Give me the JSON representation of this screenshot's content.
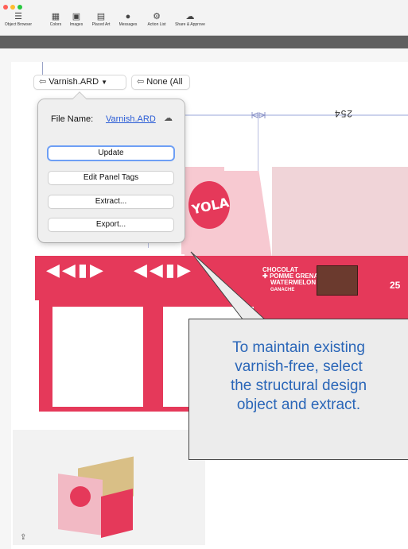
{
  "toolbar": {
    "items": [
      {
        "label": "Object Browser",
        "icon": "object-browser-icon",
        "glyph": "☰"
      },
      {
        "label": "Colors",
        "icon": "colors-icon",
        "glyph": "▦"
      },
      {
        "label": "Images",
        "icon": "images-icon",
        "glyph": "▣"
      },
      {
        "label": "Placed Art",
        "icon": "placed-art-icon",
        "glyph": "▤"
      },
      {
        "label": "Messages",
        "icon": "messages-icon",
        "glyph": "●"
      },
      {
        "label": "Action List",
        "icon": "action-list-icon",
        "glyph": "⚙"
      },
      {
        "label": "Share & Approve",
        "icon": "share-approve-icon",
        "glyph": "☁"
      }
    ]
  },
  "selectors": {
    "varnish": "Varnish.ARD",
    "none": "None (All"
  },
  "popover": {
    "file_name_label": "File Name:",
    "file_name_value": "Varnish.ARD",
    "update": "Update",
    "edit_panel_tags": "Edit Panel Tags",
    "extract": "Extract...",
    "export": "Export..."
  },
  "dimension": {
    "value": "254"
  },
  "artwork": {
    "brand": "YOLA",
    "flavor_line1": "CHOCOLAT",
    "flavor_line2": "POMME GRENATE",
    "flavor_line3": "WATERMELON",
    "flavor_line4": "GANACHE",
    "count": "25"
  },
  "callout": {
    "lines": [
      "To maintain existing",
      "varnish-free, select",
      "the structural design",
      "object and extract."
    ]
  },
  "colors": {
    "accent_pink": "#e5395a",
    "link_blue": "#2a5cd6",
    "callout_text": "#2a66b8"
  }
}
